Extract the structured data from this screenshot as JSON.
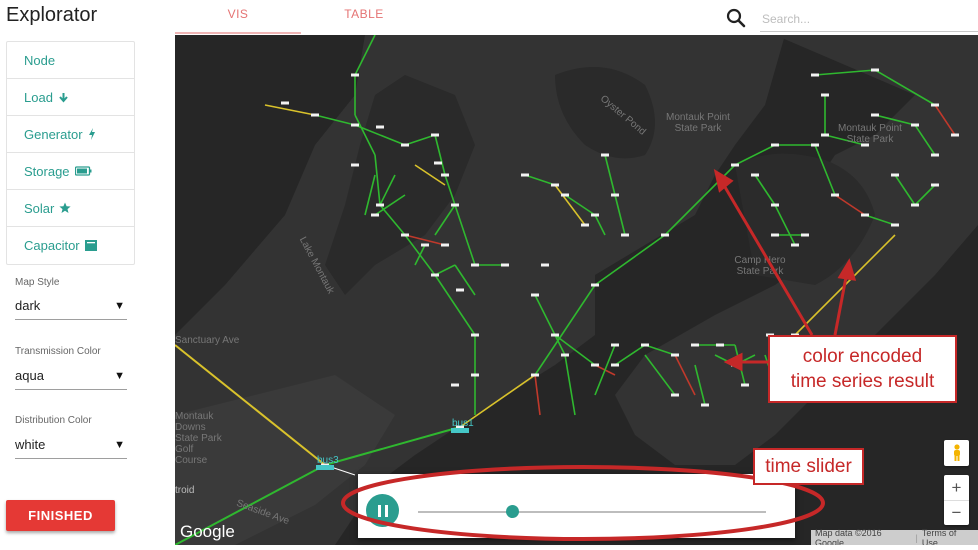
{
  "app": {
    "title": "Explorator"
  },
  "layers": [
    {
      "label": "Node",
      "icon": ""
    },
    {
      "label": "Load",
      "icon": "arrow-down-icon"
    },
    {
      "label": "Generator",
      "icon": "bolt-icon"
    },
    {
      "label": "Storage",
      "icon": "battery-icon"
    },
    {
      "label": "Solar",
      "icon": "star-icon"
    },
    {
      "label": "Capacitor",
      "icon": "capacitor-icon"
    }
  ],
  "settings": {
    "map_style": {
      "label": "Map Style",
      "value": "dark"
    },
    "transmission_color": {
      "label": "Transmission Color",
      "value": "aqua"
    },
    "distribution_color": {
      "label": "Distribution Color",
      "value": "white"
    }
  },
  "finished_label": "FINISHED",
  "tabs": [
    {
      "label": "VIS",
      "active": true
    },
    {
      "label": "TABLE",
      "active": false
    }
  ],
  "search": {
    "placeholder": "Search...",
    "value": ""
  },
  "map": {
    "labels": [
      "Oyster Pond",
      "Montauk Point State Park",
      "Montauk Point State Park",
      "Lake Montauk",
      "Camp Hero State Park",
      "Montauk Downs State Park Golf Course",
      "Seaside Ave",
      "Sanctuary Ave",
      "troid"
    ],
    "buses": [
      "bus1",
      "bus3"
    ],
    "google_logo": "Google",
    "attribution": "Map data ©2016 Google",
    "terms": "Terms of Use",
    "zoom_in": "+",
    "zoom_out": "−",
    "colors": {
      "ok": "#2fb82f",
      "warning": "#d9c22b",
      "overload": "#c0392b",
      "transmission": "#45c7c7"
    }
  },
  "time_slider": {
    "position": 0.27
  },
  "annotations": {
    "color_encoded_1": "color encoded",
    "color_encoded_2": "time series result",
    "time_slider": "time slider"
  }
}
